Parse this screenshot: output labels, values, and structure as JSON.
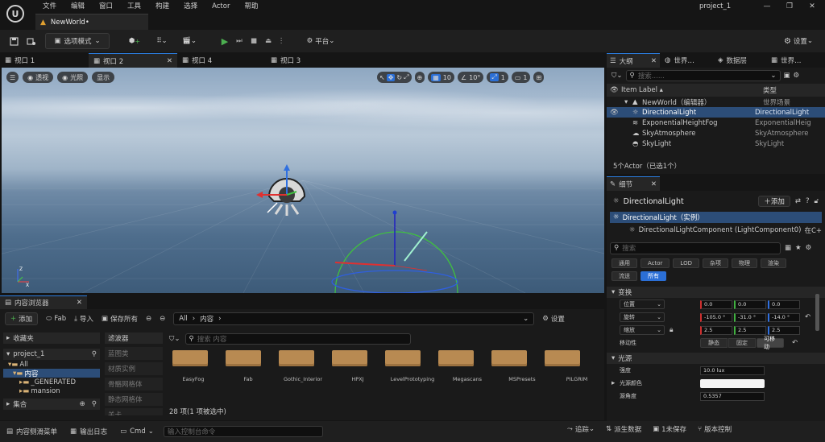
{
  "menu": [
    "文件",
    "编辑",
    "窗口",
    "工具",
    "构建",
    "选择",
    "Actor",
    "帮助"
  ],
  "project_name": "project_1",
  "window_controls": [
    "—",
    "❐",
    "✕"
  ],
  "level_tab": "NewWorld•",
  "toolbar": {
    "select_mode": "选项模式",
    "platform": "平台",
    "settings": "设置"
  },
  "viewport_tabs": [
    "视口 1",
    "视口 2",
    "视口 4",
    "视口 3"
  ],
  "viewport": {
    "perspective": "透视",
    "lighting": "光照",
    "show": "显示",
    "grid_value": "10",
    "rotation_value": "10°",
    "scale_value": "1",
    "camera_speed": "1"
  },
  "outliner": {
    "tabs": [
      "大纲",
      "世界…",
      "数据层",
      "世界…"
    ],
    "search_placeholder": "搜索......",
    "col_label": "Item Label ▴",
    "col_type": "类型",
    "items": [
      {
        "label": "NewWorld（编辑器）",
        "type": "世界场景"
      },
      {
        "label": "DirectionalLight",
        "type": "DirectionalLight"
      },
      {
        "label": "ExponentialHeightFog",
        "type": "ExponentialHeig"
      },
      {
        "label": "SkyAtmosphere",
        "type": "SkyAtmosphere"
      },
      {
        "label": "SkyLight",
        "type": "SkyLight"
      }
    ],
    "status": "5个Actor（已选1个）"
  },
  "details": {
    "title": "细节",
    "actor_name": "DirectionalLight",
    "add_label": "＋添加",
    "instance": "DirectionalLight（实例）",
    "component": "DirectionalLightComponent (LightComponent0)",
    "component_suffix": "在C+",
    "search_placeholder": "搜索",
    "filters": [
      "通用",
      "Actor",
      "LOD",
      "杂项",
      "物理",
      "渲染",
      "流送",
      "所有"
    ],
    "section_transform": "变换",
    "location_label": "位置",
    "location": [
      "0.0",
      "0.0",
      "0.0"
    ],
    "rotation_label": "旋转",
    "rotation": [
      "-105.0 °",
      "-31.0 °",
      "-14.0 °"
    ],
    "scale_label": "缩放",
    "scale": [
      "2.5",
      "2.5",
      "2.5"
    ],
    "mobility_label": "移动性",
    "mobility_options": [
      "静态",
      "固定",
      "可移动"
    ],
    "section_light": "光源",
    "intensity_label": "强度",
    "intensity": "10.0 lux",
    "light_color_label": "光源颜色",
    "source_angle_label": "源角度",
    "source_angle": "0.5357"
  },
  "content_browser": {
    "tab": "内容浏览器",
    "add": "添加",
    "fab": "Fab",
    "import": "导入",
    "save_all": "保存所有",
    "path": [
      "All",
      "内容"
    ],
    "settings": "设置",
    "favorites": "收藏夹",
    "project": "project_1",
    "tree": [
      "All",
      "内容",
      "_GENERATED",
      "mansion"
    ],
    "collections": "集合",
    "filters_title": "滤波器",
    "filters": [
      "蓝图类",
      "材质实例",
      "骨骼网格体",
      "静态网格体",
      "关卡"
    ],
    "search_placeholder": "搜索 内容",
    "folders": [
      "EasyFog",
      "Fab",
      "Gothic_Interior",
      "HPXJ",
      "LevelPrototyping",
      "Megascans",
      "MSPresets",
      "PILGRIM"
    ],
    "count": "28 项(1 项被选中)"
  },
  "statusbar": {
    "drawer": "内容侧滑菜单",
    "output": "输出日志",
    "cmd": "Cmd",
    "cmd_placeholder": "输入控制台命令",
    "trace": "追踪",
    "derived": "派生数据",
    "unsaved": "1未保存",
    "source_control": "版本控制"
  },
  "colors": {
    "accent": "#2b6fd6",
    "selection": "#2c4d78"
  }
}
